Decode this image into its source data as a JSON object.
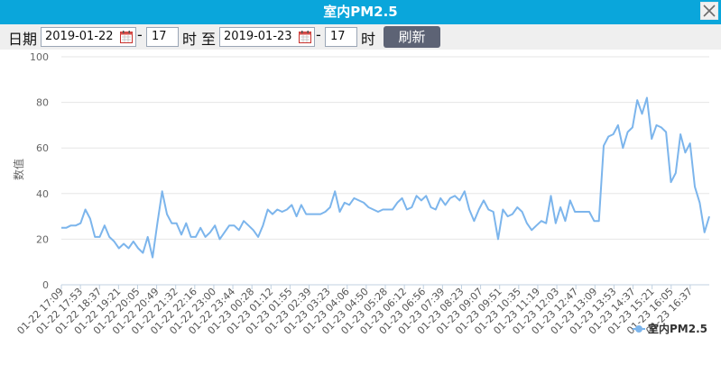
{
  "window": {
    "title": "室内PM2.5",
    "close_icon": "close-icon"
  },
  "toolbar": {
    "date_label": "日期",
    "start_date": "2019-01-22",
    "dash1": "-",
    "start_hour": "17",
    "hour_label1": "时",
    "to_label": "至",
    "end_date": "2019-01-23",
    "dash2": "-",
    "end_hour": "17",
    "hour_label2": "时",
    "refresh_label": "刷新",
    "calendar_icon": "calendar-icon"
  },
  "chart_data": {
    "type": "line",
    "title": "",
    "xlabel": "",
    "ylabel": "数值",
    "ylim": [
      0,
      100
    ],
    "y_ticks": [
      0,
      20,
      40,
      60,
      80,
      100
    ],
    "grid": true,
    "legend_position": "bottom-right",
    "color": "#7cb5ec",
    "x_tick_labels": [
      "01-22 17:09",
      "01-22 17:53",
      "01-22 18:37",
      "01-22 19:21",
      "01-22 20:05",
      "01-22 20:49",
      "01-22 21:32",
      "01-22 22:16",
      "01-22 23:00",
      "01-22 23:44",
      "01-23 00:28",
      "01-23 01:12",
      "01-23 01:55",
      "01-23 02:39",
      "01-23 03:23",
      "01-23 04:06",
      "01-23 04:50",
      "01-23 05:28",
      "01-23 06:12",
      "01-23 06:56",
      "01-23 07:39",
      "01-23 08:23",
      "01-23 09:07",
      "01-23 09:51",
      "01-23 10:35",
      "01-23 11:19",
      "01-23 12:03",
      "01-23 12:47",
      "01-23 13:09",
      "01-23 13:53",
      "01-23 14:37",
      "01-23 15:21",
      "01-23 16:05",
      "01-23 16:37"
    ],
    "series": [
      {
        "name": "室内PM2.5",
        "values": [
          25,
          25,
          26,
          26,
          27,
          33,
          29,
          21,
          21,
          26,
          21,
          19,
          16,
          18,
          16,
          19,
          16,
          14,
          21,
          12,
          27,
          41,
          31,
          27,
          27,
          22,
          27,
          21,
          21,
          25,
          21,
          23,
          26,
          20,
          23,
          26,
          26,
          24,
          28,
          26,
          24,
          21,
          26,
          33,
          31,
          33,
          32,
          33,
          35,
          30,
          35,
          31,
          31,
          31,
          31,
          32,
          34,
          41,
          32,
          36,
          35,
          38,
          37,
          36,
          34,
          33,
          32,
          33,
          33,
          33,
          36,
          38,
          33,
          34,
          39,
          37,
          39,
          34,
          33,
          38,
          35,
          38,
          39,
          37,
          41,
          33,
          28,
          33,
          37,
          33,
          32,
          20,
          33,
          30,
          31,
          34,
          32,
          27,
          24,
          26,
          28,
          27,
          39,
          27,
          34,
          28,
          37,
          32,
          32,
          32,
          32,
          28,
          28,
          61,
          65,
          66,
          70,
          60,
          67,
          69,
          81,
          75,
          82,
          64,
          70,
          69,
          67,
          45,
          49,
          66,
          58,
          62,
          43,
          36,
          23,
          30
        ]
      }
    ]
  }
}
